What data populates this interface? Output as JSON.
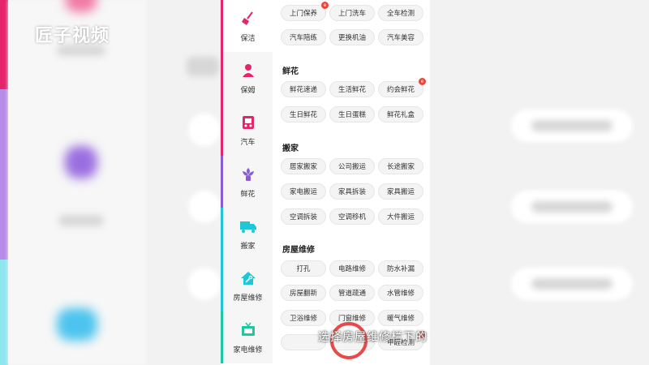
{
  "watermark": "匠子视频",
  "subtitle": "选择房屋维修栏下的",
  "colors": {
    "cleaning": "#e5256b",
    "nanny": "#e5256b",
    "car": "#e5256b",
    "flowers": "#8a5bd6",
    "moving": "#1fc6d6",
    "house_repair": "#1fc6d6",
    "appliance_repair": "#1fc6a0",
    "hot_badge": "#e8473a",
    "tap_ring": "#e84a4a"
  },
  "sidebar": {
    "items": [
      {
        "label": "保洁",
        "icon": "broom-icon",
        "color": "#e5256b"
      },
      {
        "label": "保姆",
        "icon": "nanny-icon",
        "color": "#e5256b"
      },
      {
        "label": "汽车",
        "icon": "car-icon",
        "color": "#e5256b"
      },
      {
        "label": "鲜花",
        "icon": "flower-icon",
        "color": "#8a5bd6"
      },
      {
        "label": "搬家",
        "icon": "truck-icon",
        "color": "#1fc6d6"
      },
      {
        "label": "房屋维修",
        "icon": "house-repair-icon",
        "color": "#1fc6d6"
      },
      {
        "label": "家电维修",
        "icon": "tv-icon",
        "color": "#1fc6a0"
      }
    ]
  },
  "sections": {
    "car": {
      "title": "",
      "items": [
        "上门保养",
        "上门洗车",
        "全车检测",
        "汽车陪练",
        "更换机油",
        "汽车美容"
      ]
    },
    "flowers": {
      "title": "鲜花",
      "items": [
        "鲜花速递",
        "生活鲜花",
        "约会鲜花",
        "生日鲜花",
        "生日蛋糕",
        "鲜花礼盒"
      ]
    },
    "moving": {
      "title": "搬家",
      "items": [
        "居家搬家",
        "公司搬运",
        "长途搬家",
        "家电搬运",
        "家具拆装",
        "家具搬运",
        "空调拆装",
        "空调移机",
        "大件搬运"
      ]
    },
    "house_repair": {
      "title": "房屋维修",
      "items": [
        "打孔",
        "电路维修",
        "防水补漏",
        "房屋翻新",
        "管道疏通",
        "水管维修",
        "卫浴维修",
        "门窗维修",
        "暖气维修",
        "",
        "",
        "甲醛检测"
      ]
    }
  },
  "hot_badge": "e"
}
